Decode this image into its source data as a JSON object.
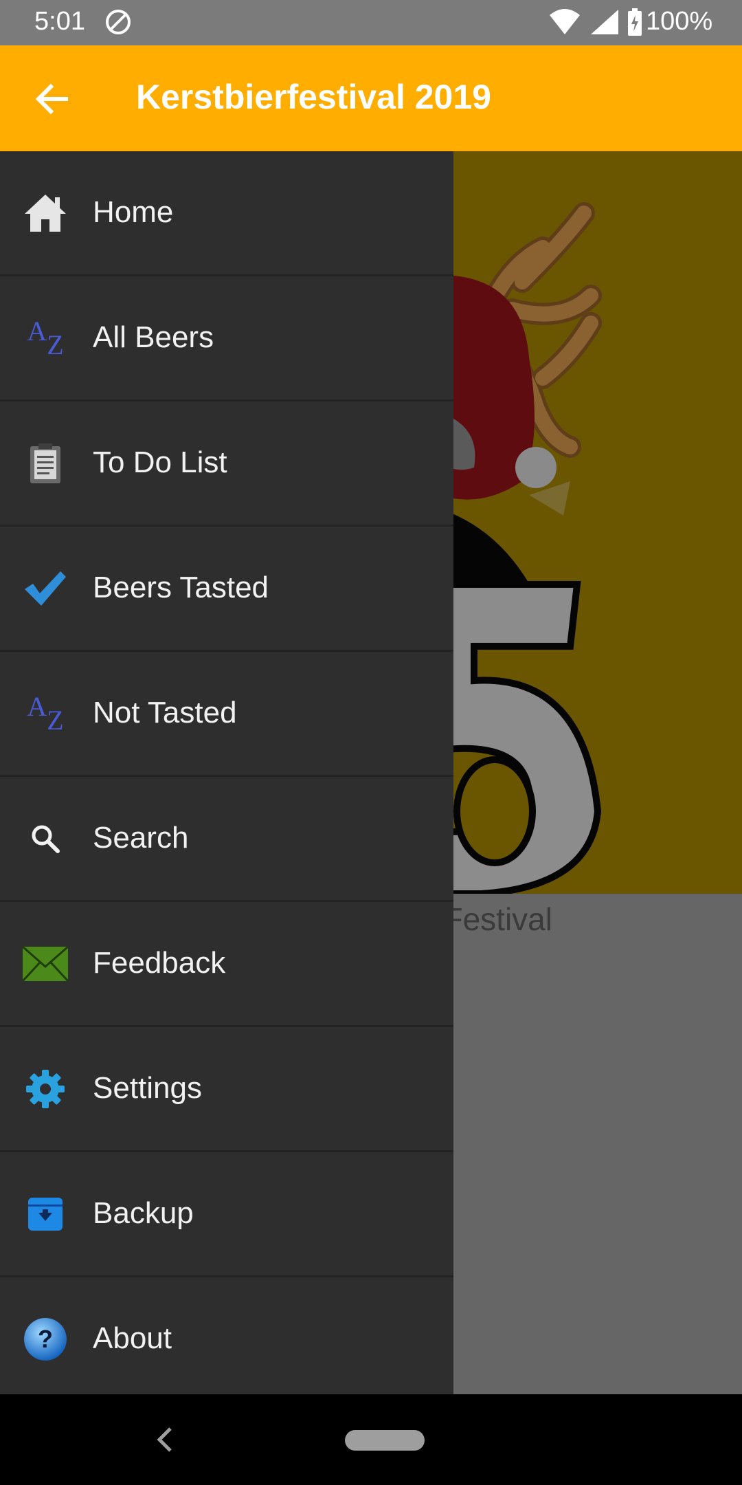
{
  "status_bar": {
    "time": "5:01",
    "battery": "100%"
  },
  "app_bar": {
    "title": "Kerstbierfestival 2019",
    "back_icon": "arrow-back-icon"
  },
  "background": {
    "caption": "bier Festival"
  },
  "drawer": {
    "items": [
      {
        "label": "Home",
        "icon": "home-icon"
      },
      {
        "label": "All Beers",
        "icon": "az-sort-icon"
      },
      {
        "label": "To Do List",
        "icon": "clipboard-icon"
      },
      {
        "label": "Beers Tasted",
        "icon": "checkmark-icon"
      },
      {
        "label": "Not Tasted",
        "icon": "az-sort-icon"
      },
      {
        "label": "Search",
        "icon": "search-icon"
      },
      {
        "label": "Feedback",
        "icon": "envelope-icon"
      },
      {
        "label": "Settings",
        "icon": "gear-icon"
      },
      {
        "label": "Backup",
        "icon": "archive-icon"
      },
      {
        "label": "About",
        "icon": "help-icon"
      }
    ]
  },
  "colors": {
    "app_bar": "#ffad00",
    "drawer_bg": "#2e2e2f",
    "status_bar": "#7b7b7b"
  }
}
